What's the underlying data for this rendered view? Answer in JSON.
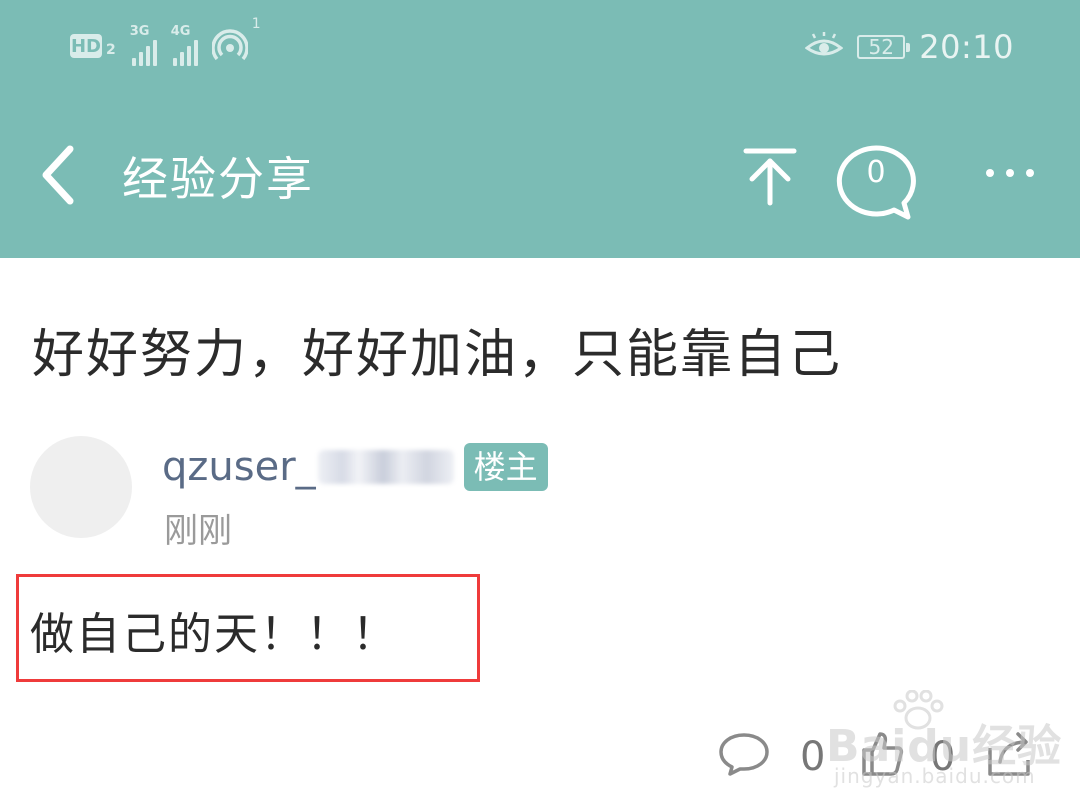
{
  "status_bar": {
    "hd_label": "HD",
    "hd_sub": "2",
    "net1": "3G",
    "net2": "4G",
    "wifi_sup": "1",
    "battery": "52",
    "time": "20:10"
  },
  "header": {
    "title": "经验分享",
    "comment_count": "0",
    "colors": {
      "bar": "#7bbcb5",
      "icon": "#ffffff"
    }
  },
  "post": {
    "title": "好好努力，好好加油，只能靠自己",
    "author": "qzuser_",
    "owner_badge": "楼主",
    "time": "刚刚",
    "content": "做自己的天！！！",
    "highlight_color": "#ef3b3b"
  },
  "actions": {
    "reply_count": "0",
    "like_count": "0"
  },
  "watermark": {
    "brand": "Baidu经验",
    "url": "jingyan.baidu.com"
  }
}
